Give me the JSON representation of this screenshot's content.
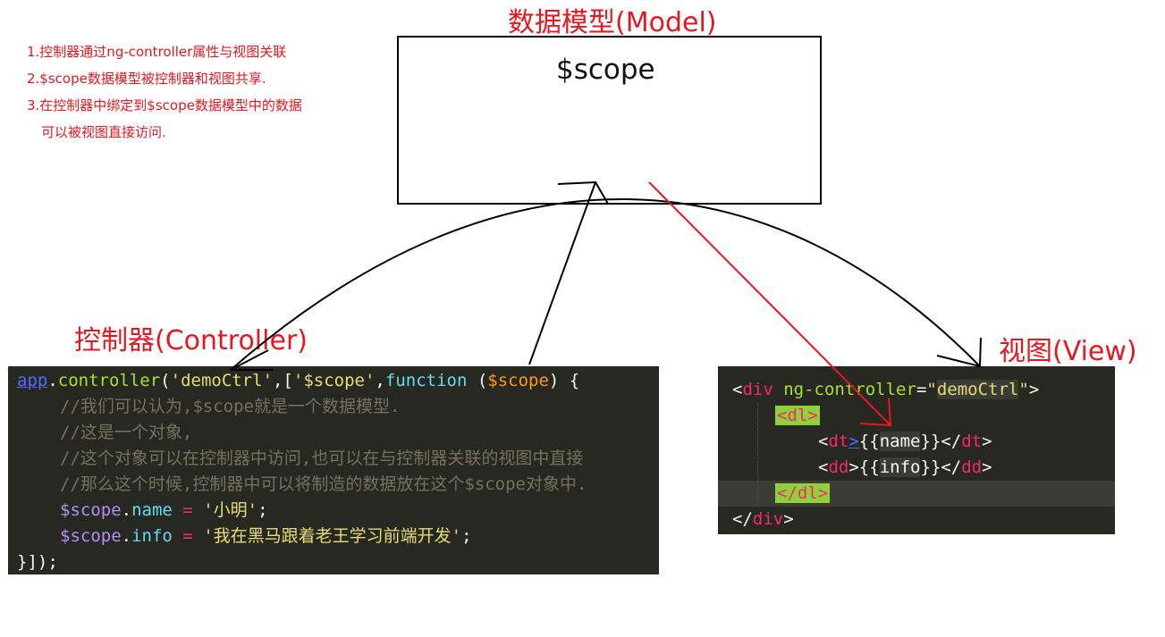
{
  "notes": [
    "1.控制器通过ng-controller属性与视图关联",
    "2.$scope数据模型被控制器和视图共享.",
    "3.在控制器中绑定到$scope数据模型中的数据",
    "可以被视图直接访问."
  ],
  "titles": {
    "model": "数据模型(Model)",
    "controller": "控制器(Controller)",
    "view": "视图(View)"
  },
  "model_box": {
    "label": "$scope"
  },
  "controller_code": {
    "l1": {
      "app": "app",
      "dot": ".",
      "fn": "controller",
      "p1": "(",
      "s1": "'demoCtrl'",
      "p2": ",[",
      "s2": "'$scope'",
      "p3": ",",
      "kw": "function",
      "p4": " (",
      "arg": "$scope",
      "p5": ") {"
    },
    "comments": [
      "//我们可以认为,$scope就是一个数据模型.",
      "//这是一个对象,",
      "//这个对象可以在控制器中访问,也可以在与控制器关联的视图中直接",
      "//那么这个时候,控制器中可以将制造的数据放在这个$scope对象中."
    ],
    "name_line": {
      "obj": "$scope",
      "dot": ".",
      "prop": "name",
      "eq": " = ",
      "val": "'小明'",
      "end": ";"
    },
    "info_line": {
      "obj": "$scope",
      "dot": ".",
      "prop": "info",
      "eq": " = ",
      "val": "'我在黑马跟着老王学习前端开发'",
      "end": ";"
    },
    "last": "}]);"
  },
  "view_code": {
    "div_open": {
      "lt": "<",
      "tag": "div",
      "attr": " ng-controller",
      "eq": "=",
      "q1": "\"",
      "val": "demoCtrl",
      "q2": "\"",
      "gt": ">"
    },
    "dl_open": "<dl>",
    "dt_line": {
      "lt": "<",
      "tag": "dt",
      "gt": ">",
      "expr_open": "{{",
      "expr": "name",
      "expr_close": "}}",
      "close": "</",
      "ctag": "dt",
      "cgt": ">"
    },
    "dd_line": {
      "lt": "<",
      "tag": "dd",
      "gt": ">",
      "expr_open": "{{",
      "expr": "info",
      "expr_close": "}}",
      "close": "</",
      "ctag": "dd",
      "cgt": ">"
    },
    "dl_close": "</dl>",
    "div_close": {
      "lt": "</",
      "tag": "div",
      "gt": ">"
    }
  },
  "colors": {
    "annotation_red": "#e5171f",
    "code_bg": "#272822",
    "comment": "#75715e",
    "string": "#e6db74",
    "tag": "#f92672",
    "attribute": "#a6e22e"
  }
}
